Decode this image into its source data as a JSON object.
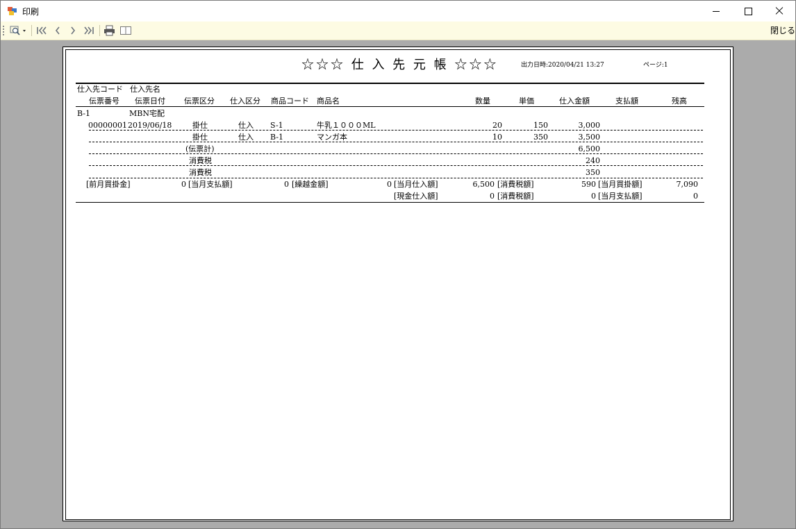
{
  "window": {
    "title": "印刷"
  },
  "toolbar": {
    "zoom_icon": "magnifier-dropdown-icon",
    "first_page_icon": "first-page-icon",
    "prev_page_icon": "prev-page-icon",
    "next_page_icon": "next-page-icon",
    "last_page_icon": "last-page-icon",
    "print_icon": "printer-icon",
    "layout_icon": "page-layout-icon",
    "close_label": "閉じる"
  },
  "report": {
    "title": "☆☆☆ 仕 入 先 元 帳 ☆☆☆",
    "output_datetime": "出力日時:2020/04/21 13:27",
    "page": "ページ:1",
    "headers": {
      "supplier_code": "仕入先コード",
      "supplier_name": "仕入先名",
      "slip_no": "伝票番号",
      "slip_date": "伝票日付",
      "slip_type": "伝票区分",
      "purchase_type": "仕入区分",
      "product_code": "商品コード",
      "product_name": "商品名",
      "quantity": "数量",
      "unit_price": "単価",
      "purchase_amount": "仕入金額",
      "payment": "支払額",
      "balance": "残高"
    },
    "supplier": {
      "code": "B-1",
      "name": "MBN宅配"
    },
    "rows": [
      {
        "slip_no": "00000001",
        "date": "2019/06/18",
        "slip_type": "掛仕",
        "purchase_type": "仕入",
        "product_code": "S-1",
        "product_name": "牛乳１０００ML",
        "quantity": "20",
        "unit_price": "150",
        "amount": "3,000"
      },
      {
        "slip_no": "",
        "date": "",
        "slip_type": "掛仕",
        "purchase_type": "仕入",
        "product_code": "B-1",
        "product_name": "マンガ本",
        "quantity": "10",
        "unit_price": "350",
        "amount": "3,500"
      }
    ],
    "slip_total": {
      "label": "(伝票計)",
      "amount": "6,500"
    },
    "tax_rows": [
      {
        "label": "消費税",
        "amount": "240"
      },
      {
        "label": "消費税",
        "amount": "350"
      }
    ],
    "summary1": [
      {
        "label": "[前月買掛金]",
        "value": "0"
      },
      {
        "label": "[当月支払額]",
        "value": "0"
      },
      {
        "label": "[繰越金額]",
        "value": "0"
      },
      {
        "label": "[当月仕入額]",
        "value": "6,500"
      },
      {
        "label": "[消費税額]",
        "value": "590"
      },
      {
        "label": "[当月買掛額]",
        "value": "7,090"
      }
    ],
    "summary2": [
      {
        "label": "[現金仕入額]",
        "value": "0"
      },
      {
        "label": "[消費税額]",
        "value": "0"
      },
      {
        "label": "[当月支払額]",
        "value": "0"
      }
    ]
  }
}
